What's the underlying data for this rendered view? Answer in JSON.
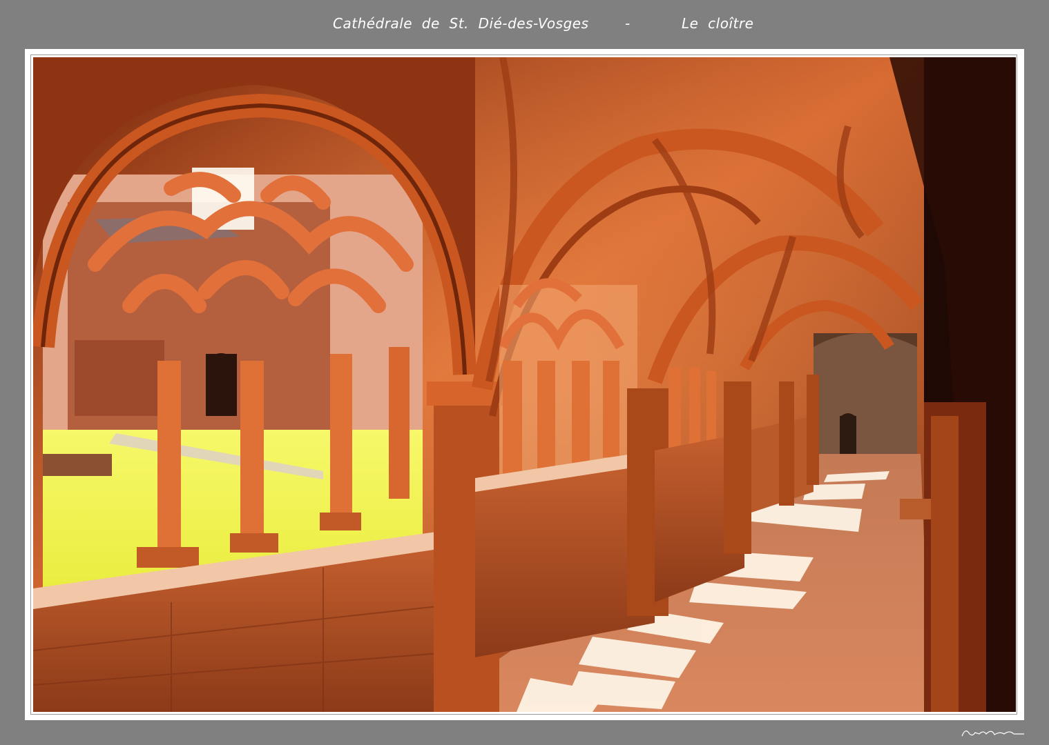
{
  "caption": {
    "left": "Cathédrale  de  St.  Dié-des-Vosges",
    "separator": "-",
    "right": "Le  cloître"
  },
  "colors": {
    "background": "#808080",
    "mat": "#ffffff",
    "stone": "#d2602a",
    "grass": "#f3f55a"
  }
}
